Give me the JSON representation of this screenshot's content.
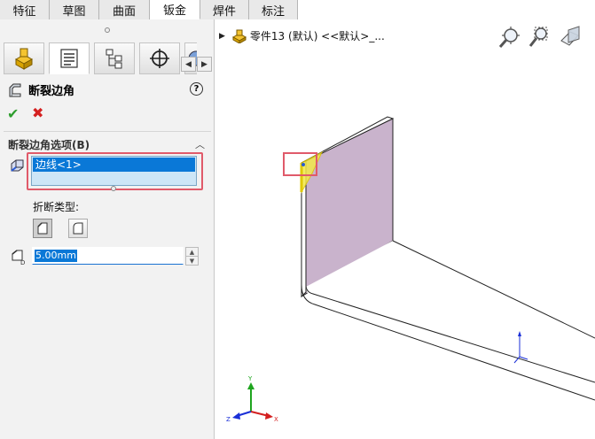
{
  "tabs": [
    {
      "label": "特征",
      "width": 56
    },
    {
      "label": "草图",
      "width": 56
    },
    {
      "label": "曲面",
      "width": 57
    },
    {
      "label": "钣金",
      "width": 57,
      "active": true
    },
    {
      "label": "焊件",
      "width": 55
    },
    {
      "label": "标注",
      "width": 55
    }
  ],
  "panel": {
    "feature_title": "断裂边角",
    "help_label": "?",
    "ok_symbol": "✔",
    "cancel_symbol": "✖",
    "group_title": "断裂边角选项(B)",
    "group_collapse_symbol": "︿",
    "selection_item": "边线<1>",
    "break_type_label": "折断类型:",
    "distance_value": "5.00mm"
  },
  "graphics": {
    "tree_label": "零件13 (默认) <<默认>_..."
  },
  "colors": {
    "accent": "#0a78d7",
    "highlight_outline": "#e05a6a",
    "face_fill": "#c9b3cc",
    "edge_highlight": "#f2e84a"
  }
}
